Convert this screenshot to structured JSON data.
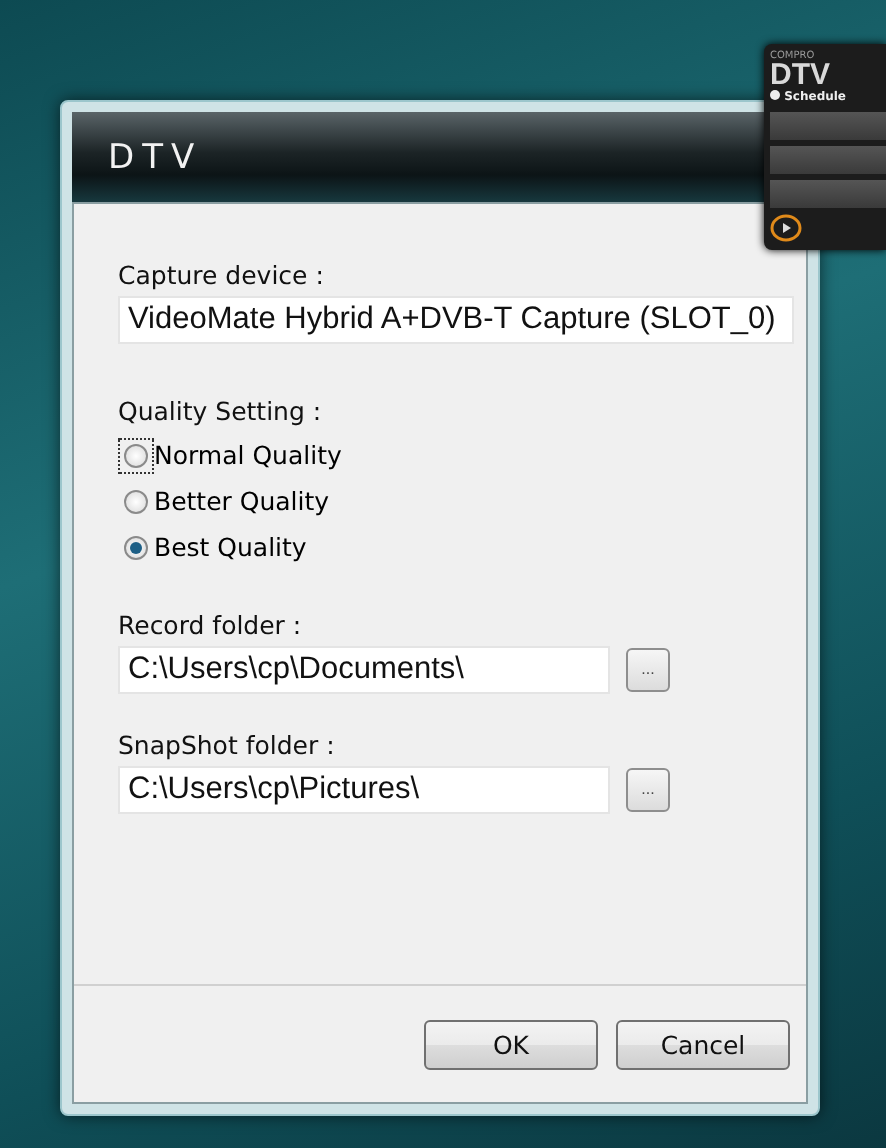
{
  "gadget": {
    "brand": "COMPRO",
    "title": "DTV",
    "menu": "Schedule"
  },
  "window": {
    "title": "DTV"
  },
  "capture_device": {
    "label": "Capture device :",
    "value": "VideoMate Hybrid A+DVB-T Capture (SLOT_0)"
  },
  "quality": {
    "label": "Quality Setting :",
    "options": [
      {
        "label": "Normal Quality",
        "selected": false,
        "focused": true
      },
      {
        "label": "Better Quality",
        "selected": false,
        "focused": false
      },
      {
        "label": "Best Quality",
        "selected": true,
        "focused": false
      }
    ]
  },
  "folders": [
    {
      "label": "Record folder :",
      "value": "C:\\Users\\cp\\Documents\\",
      "browse": "..."
    },
    {
      "label": "SnapShot folder :",
      "value": "C:\\Users\\cp\\Pictures\\",
      "browse": "..."
    }
  ],
  "buttons": [
    "OK",
    "Cancel"
  ]
}
